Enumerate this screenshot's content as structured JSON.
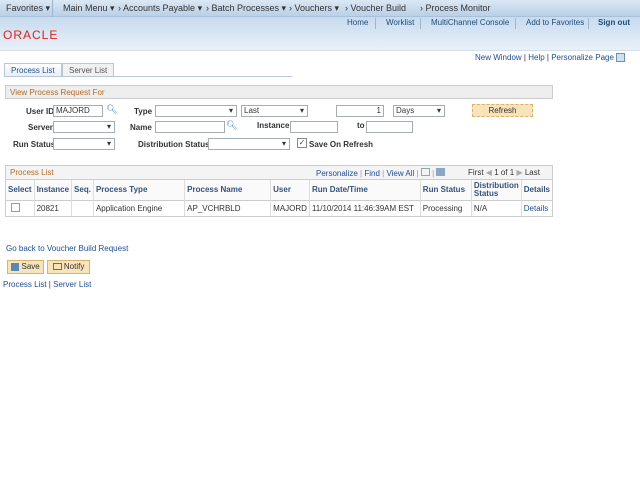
{
  "nav": {
    "favorites": "Favorites",
    "main_menu": "Main Menu",
    "breadcrumbs": [
      "Accounts Payable",
      "Batch Processes",
      "Vouchers",
      "Voucher Build",
      "Process Monitor"
    ]
  },
  "header": {
    "links": [
      "Home",
      "Worklist",
      "MultiChannel Console",
      "Add to Favorites",
      "Sign out"
    ],
    "logo": "ORACLE"
  },
  "pagebar": {
    "new_window": "New Window",
    "help": "Help",
    "personalize": "Personalize Page"
  },
  "tabs": [
    "Process List",
    "Server List"
  ],
  "filter": {
    "title": "View Process Request For",
    "user_id_label": "User ID",
    "user_id": "MAJORD",
    "type_label": "Type",
    "type": "",
    "last": "Last",
    "count": "1",
    "unit": "Days",
    "refresh": "Refresh",
    "server_label": "Server",
    "name_label": "Name",
    "instance_label": "Instance",
    "to_label": "to",
    "run_status_label": "Run Status",
    "dist_status_label": "Distribution Status",
    "save_on_refresh": "Save On Refresh",
    "save_on_refresh_checked": true
  },
  "grid": {
    "title": "Process List",
    "personalize": "Personalize",
    "find": "Find",
    "view_all": "View All",
    "first": "First",
    "pages": "1 of 1",
    "last": "Last",
    "columns": [
      "Select",
      "Instance",
      "Seq.",
      "Process Type",
      "Process Name",
      "User",
      "Run Date/Time",
      "Run Status",
      "Distribution Status",
      "Details"
    ],
    "rows": [
      {
        "instance": "20821",
        "seq": "",
        "process_type": "Application Engine",
        "process_name": "AP_VCHRBLD",
        "user": "MAJORD",
        "run_datetime": "11/10/2014 11:46:39AM EST",
        "run_status": "Processing",
        "dist_status": "N/A",
        "details": "Details"
      }
    ]
  },
  "footer": {
    "go_back": "Go back to Voucher Build Request",
    "save": "Save",
    "notify": "Notify",
    "links": [
      "Process List",
      "Server List"
    ]
  }
}
